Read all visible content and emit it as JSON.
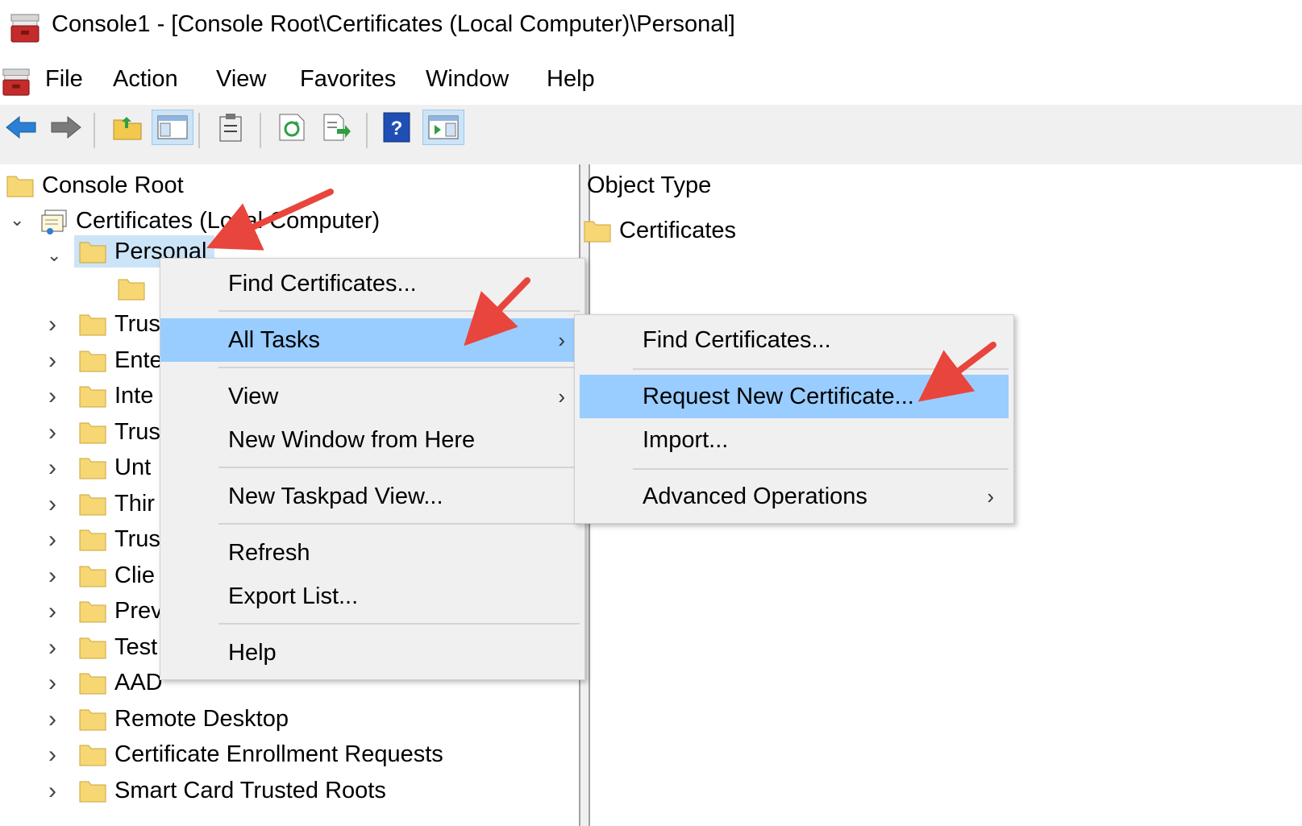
{
  "window": {
    "title": "Console1 - [Console Root\\Certificates (Local Computer)\\Personal]",
    "icon": "mmc-toolbox-icon"
  },
  "menubar": {
    "items": [
      {
        "label": "File"
      },
      {
        "label": "Action"
      },
      {
        "label": "View"
      },
      {
        "label": "Favorites"
      },
      {
        "label": "Window"
      },
      {
        "label": "Help"
      }
    ]
  },
  "toolbar": {
    "buttons": [
      {
        "icon": "back-arrow-icon"
      },
      {
        "icon": "forward-arrow-icon"
      },
      {
        "icon": "up-folder-icon"
      },
      {
        "icon": "show-hide-tree-icon",
        "pressed": true
      },
      {
        "icon": "clipboard-icon"
      },
      {
        "icon": "refresh-icon"
      },
      {
        "icon": "export-list-icon"
      },
      {
        "icon": "help-icon"
      },
      {
        "icon": "show-hide-action-pane-icon",
        "pressed": true
      }
    ]
  },
  "tree": {
    "root": "Console Root",
    "certificates_node": "Certificates (Local Computer)",
    "personal": "Personal",
    "children_truncated": [
      "Trus",
      "Ente",
      "Inte",
      "Trus",
      "Unt",
      "Thir",
      "Trus",
      "Clie",
      "Prev",
      "Test",
      "AAD"
    ],
    "children_visible": [
      "Remote Desktop",
      "Certificate Enrollment Requests",
      "Smart Card Trusted Roots"
    ]
  },
  "right_pane": {
    "column_header": "Object Type",
    "items": [
      "Certificates"
    ]
  },
  "context_menu": {
    "items": [
      {
        "label": "Find Certificates..."
      },
      {
        "label": "All Tasks",
        "submenu": true,
        "highlighted": true
      },
      {
        "label": "View",
        "submenu": true
      },
      {
        "label": "New Window from Here"
      },
      {
        "label": "New Taskpad View..."
      },
      {
        "label": "Refresh"
      },
      {
        "label": "Export List..."
      },
      {
        "label": "Help"
      }
    ]
  },
  "submenu": {
    "items": [
      {
        "label": "Find Certificates..."
      },
      {
        "label": "Request New Certificate...",
        "highlighted": true
      },
      {
        "label": "Import..."
      },
      {
        "label": "Advanced Operations",
        "submenu": true
      }
    ]
  },
  "colors": {
    "highlight": "#99ccff",
    "annotation_arrow": "#e8453c",
    "menu_bg": "#f0f0f0"
  }
}
